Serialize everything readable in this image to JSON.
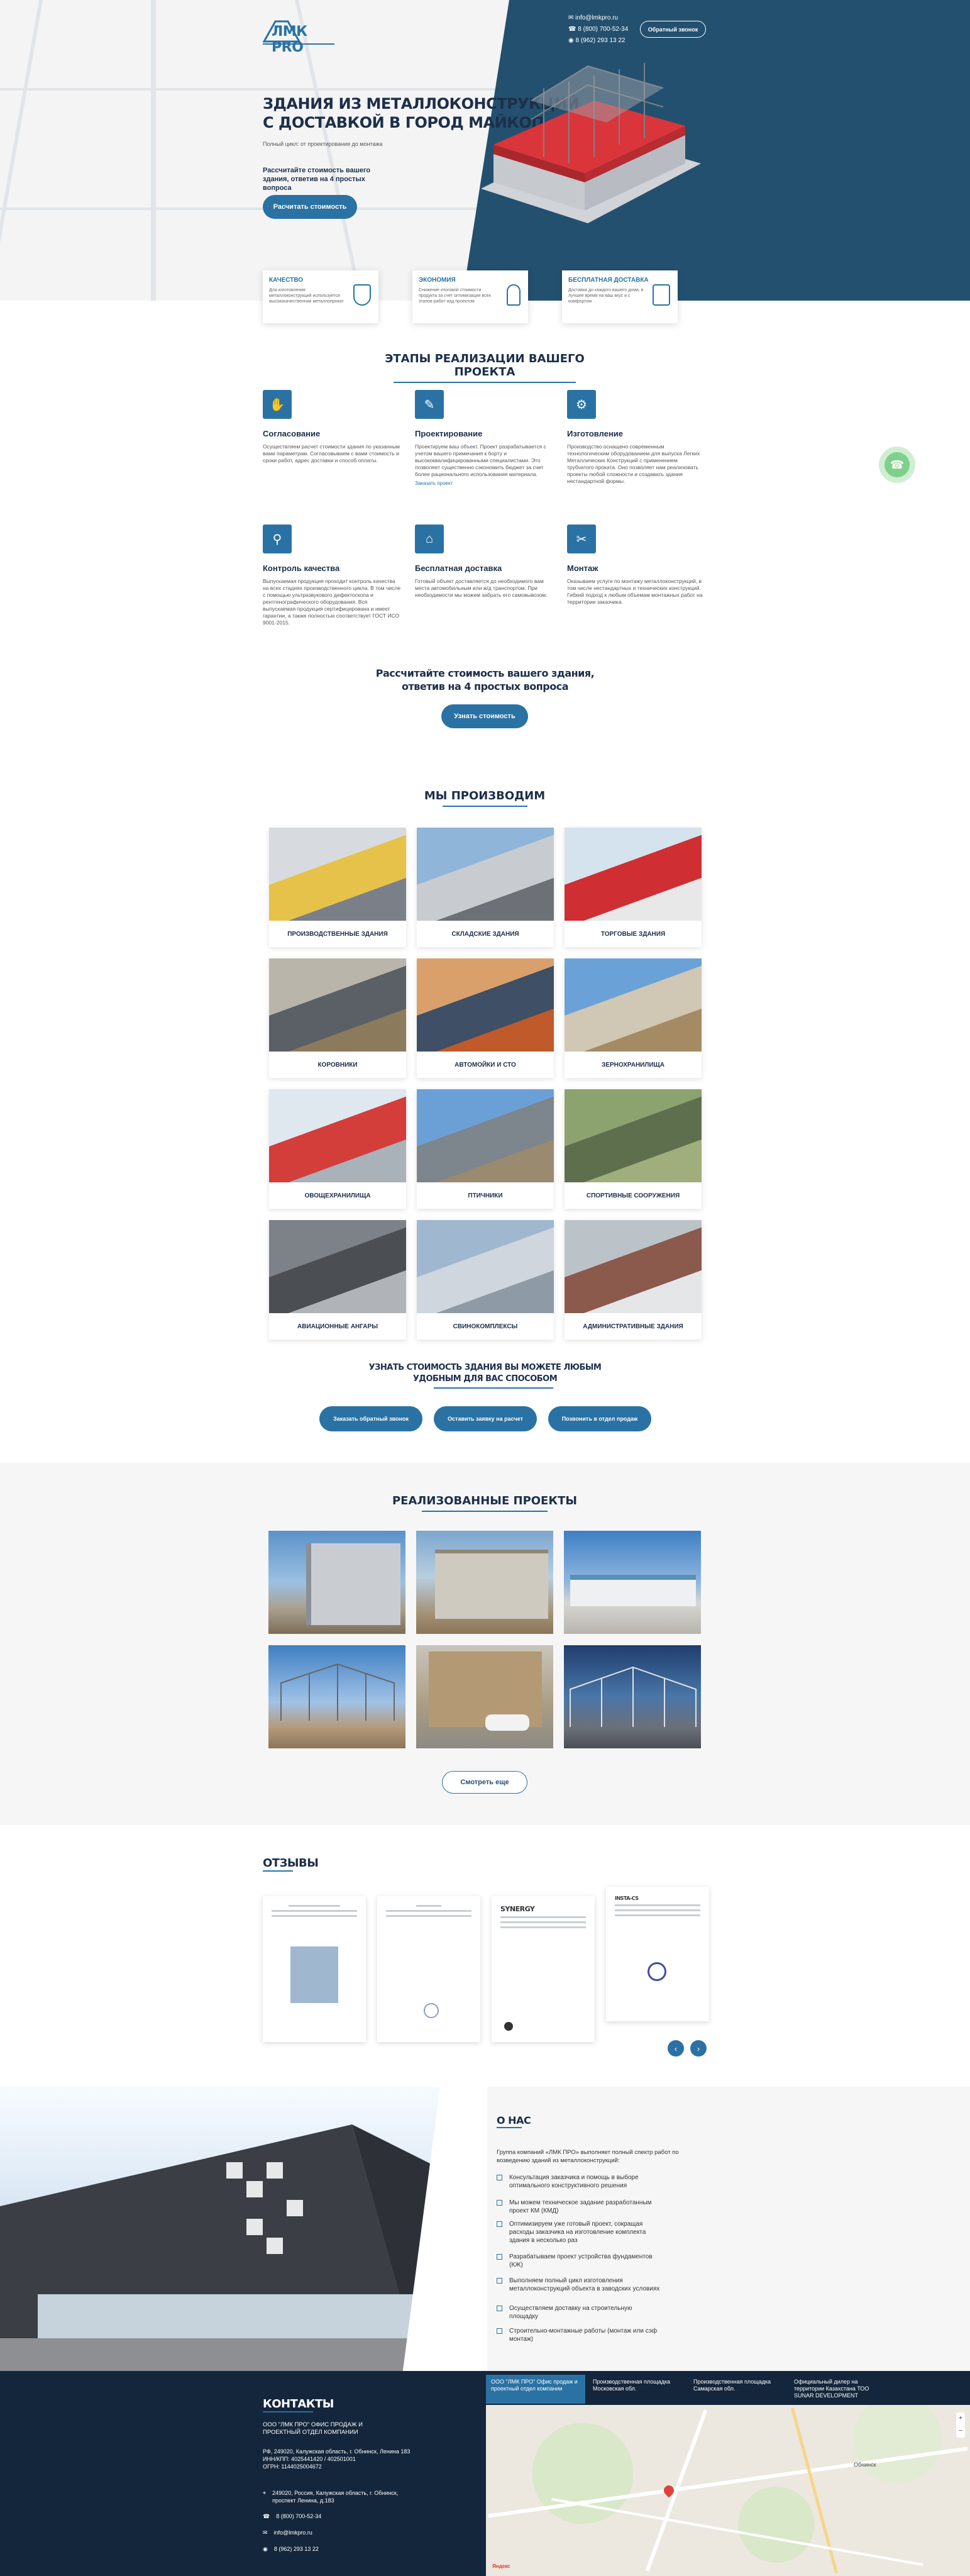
{
  "header": {
    "logo": "ЛМК PRO",
    "email": "info@lmkpro.ru",
    "phone1": "8 (800) 700-52-34",
    "phone2": "8 (962) 293 13 22",
    "callback_button": "Обратный звонок"
  },
  "hero": {
    "title_line1": "ЗДАНИЯ ИЗ МЕТАЛЛОКОНСТРУКЦИЙ",
    "title_line2": "С ДОСТАВКОЙ В ГОРОД МАЙКОП",
    "subtitle": "Полный цикл: от проектирования до монтажа",
    "cta_text": "Рассчитайте стоимость вашего здания, ответив на 4 простых вопроса",
    "cta_button": "Расчитать стоимость"
  },
  "features": [
    {
      "title": "Качество",
      "text": "Для изготовления металлоконструкций используется высококачественная металлопрокат",
      "icon": "shield-icon"
    },
    {
      "title": "Экономия",
      "text": "Снижение итоговой стоимости продукта за счет оптимизации всех этапов работ над проектом",
      "icon": "bulb-icon"
    },
    {
      "title": "Бесплатная доставка",
      "text": "Доставка до каждого вашего дома, в лучшее время на ваш вкус и с комфортом",
      "icon": "clipboard-icon"
    }
  ],
  "stages": {
    "title": "ЭТАПЫ РЕАЛИЗАЦИИ ВАШЕГО ПРОЕКТА",
    "items": [
      {
        "title": "Согласование",
        "text": "Осуществляем расчет стоимости здания по указанным вами параметрам. Согласовываем с вами стоимость и сроки работ, адрес доставки и способ оплаты.",
        "link": ""
      },
      {
        "title": "Проектирование",
        "text": "Проектируем ваш объект. Проект разрабатывается с учетом вашего примечания к борту и высококвалифицированными специалистами. Это позволяет существенно сэкономить бюджет за счет более рационального использования материала.",
        "link": "Заказать проект"
      },
      {
        "title": "Изготовление",
        "text": "Производство оснащено современным технологическим оборудованием для выпуска Легких Металлических Конструкций с применением трубчатого проката. Оно позволяет нам реализовать проекты любой сложности и создавать здания нестандартной формы.",
        "link": ""
      },
      {
        "title": "Контроль качества",
        "text": "Выпускаемая продукция проходит контроль качества на всех стадиях производственного цикла. В том числе с помощью ультразвукового дефектоскопа и рентгенографического оборудования. Вся выпускаемая продукция сертифицирована и имеет гарантии, а также полностью соответствует ГОСТ ИСО 9001-2015.",
        "link": ""
      },
      {
        "title": "Бесплатная доставка",
        "text": "Готовый объект доставляется до необходимого вам места автомобильным или ж/д транспортом. При необходимости мы можем забрать его самовывозом.",
        "link": ""
      },
      {
        "title": "Монтаж",
        "text": "Оказываем услуги по монтажу металлоконструкций, в том числе нестандартных и технических конструкций. Гибкий подход к любым объемам монтажных работ на территории заказчика.",
        "link": ""
      }
    ]
  },
  "calc": {
    "line1": "Рассчитайте стоимость вашего здания,",
    "line2": "ответив на 4 простых вопроса",
    "button": "Узнать стоимость"
  },
  "production": {
    "title": "МЫ ПРОИЗВОДИМ",
    "items": [
      "ПРОИЗВОДСТВЕННЫЕ ЗДАНИЯ",
      "СКЛАДСКИЕ ЗДАНИЯ",
      "ТОРГОВЫЕ ЗДАНИЯ",
      "КОРОВНИКИ",
      "АВТОМОЙКИ И СТО",
      "ЗЕРНОХРАНИЛИЩА",
      "ОВОЩЕХРАНИЛИЩА",
      "ПТИЧНИКИ",
      "СПОРТИВНЫЕ СООРУЖЕНИЯ",
      "АВИАЦИОННЫЕ АНГАРЫ",
      "СВИНОКОМПЛЕКСЫ",
      "АДМИНИСТРАТИВНЫЕ ЗДАНИЯ"
    ],
    "ask_line1": "УЗНАТЬ СТОИМОСТЬ ЗДАНИЯ ВЫ МОЖЕТЕ ЛЮБЫМ",
    "ask_line2": "УДОБНЫМ ДЛЯ ВАС СПОСОБОМ",
    "buttons": [
      "Заказать обратный звонок",
      "Оставить заявку на расчет",
      "Позвонить в отдел продаж"
    ]
  },
  "projects": {
    "title": "РЕАЛИЗОВАННЫЕ ПРОЕКТЫ",
    "button": "Смотреть еще"
  },
  "reviews": {
    "title": "ОТЗЫВЫ",
    "logo3": "SYNERGY",
    "logo4": "INSTA-CS"
  },
  "about": {
    "title": "О НАС",
    "intro": "Группа компаний «ЛМК ПРО» выполняет полный спектр работ по возведению зданий из металлоконструкций:",
    "items": [
      "Консультация заказчика и помощь в выборе оптимального конструктивного решения",
      "Мы можем техническое задание разработанным проект КМ (КМД)",
      "Оптимизируем уже готовый проект, сокращая расходы заказчика на изготовление комплекта здания в несколько раз",
      "Разрабатываем проект устройства фундаментов (КЖ)",
      "Выполняем полный цикл изготовления металлоконструкций объекта в заводских условиях",
      "Осуществляем доставку на строительную площадку",
      "Строительно-монтажные работы (монтаж или сэф монтаж)"
    ]
  },
  "contacts": {
    "title": "КОНТАКТЫ",
    "company": "ООО \"ЛМК ПРО\" ОФИС ПРОДАЖ И ПРОЕКТНЫЙ ОТДЕЛ КОМПАНИИ",
    "legal1": "РФ, 249020, Калужская область, г. Обнинск, Ленина 183",
    "legal2": "ИНН/КПП: 4025441420 / 402501001",
    "legal3": "ОГРН: 1144025004672",
    "address": "249020, Россия, Калужская область, г. Обнинск, проспект Ленина, д.183",
    "phone1": "8 (800) 700-52-34",
    "email": "info@lmkpro.ru",
    "phone2": "8 (962) 293 13 22",
    "tabs": [
      "ООО \"ЛМК ПРО\" Офис продаж и проектный отдел компании",
      "Производственная площадка Московская обл.",
      "Производственная площадка Самарская обл.",
      "Официальный дилер на территории Казахстана ТОО SUNAR DEVELOPMENT"
    ],
    "map_credit": "Яндекс",
    "map_place": "Обнинск"
  },
  "colors": {
    "brand": "#2a72a3",
    "dark": "#24506f",
    "footer": "#14263b",
    "accent_green": "#7fd08b",
    "roof_red": "#d9353a"
  }
}
